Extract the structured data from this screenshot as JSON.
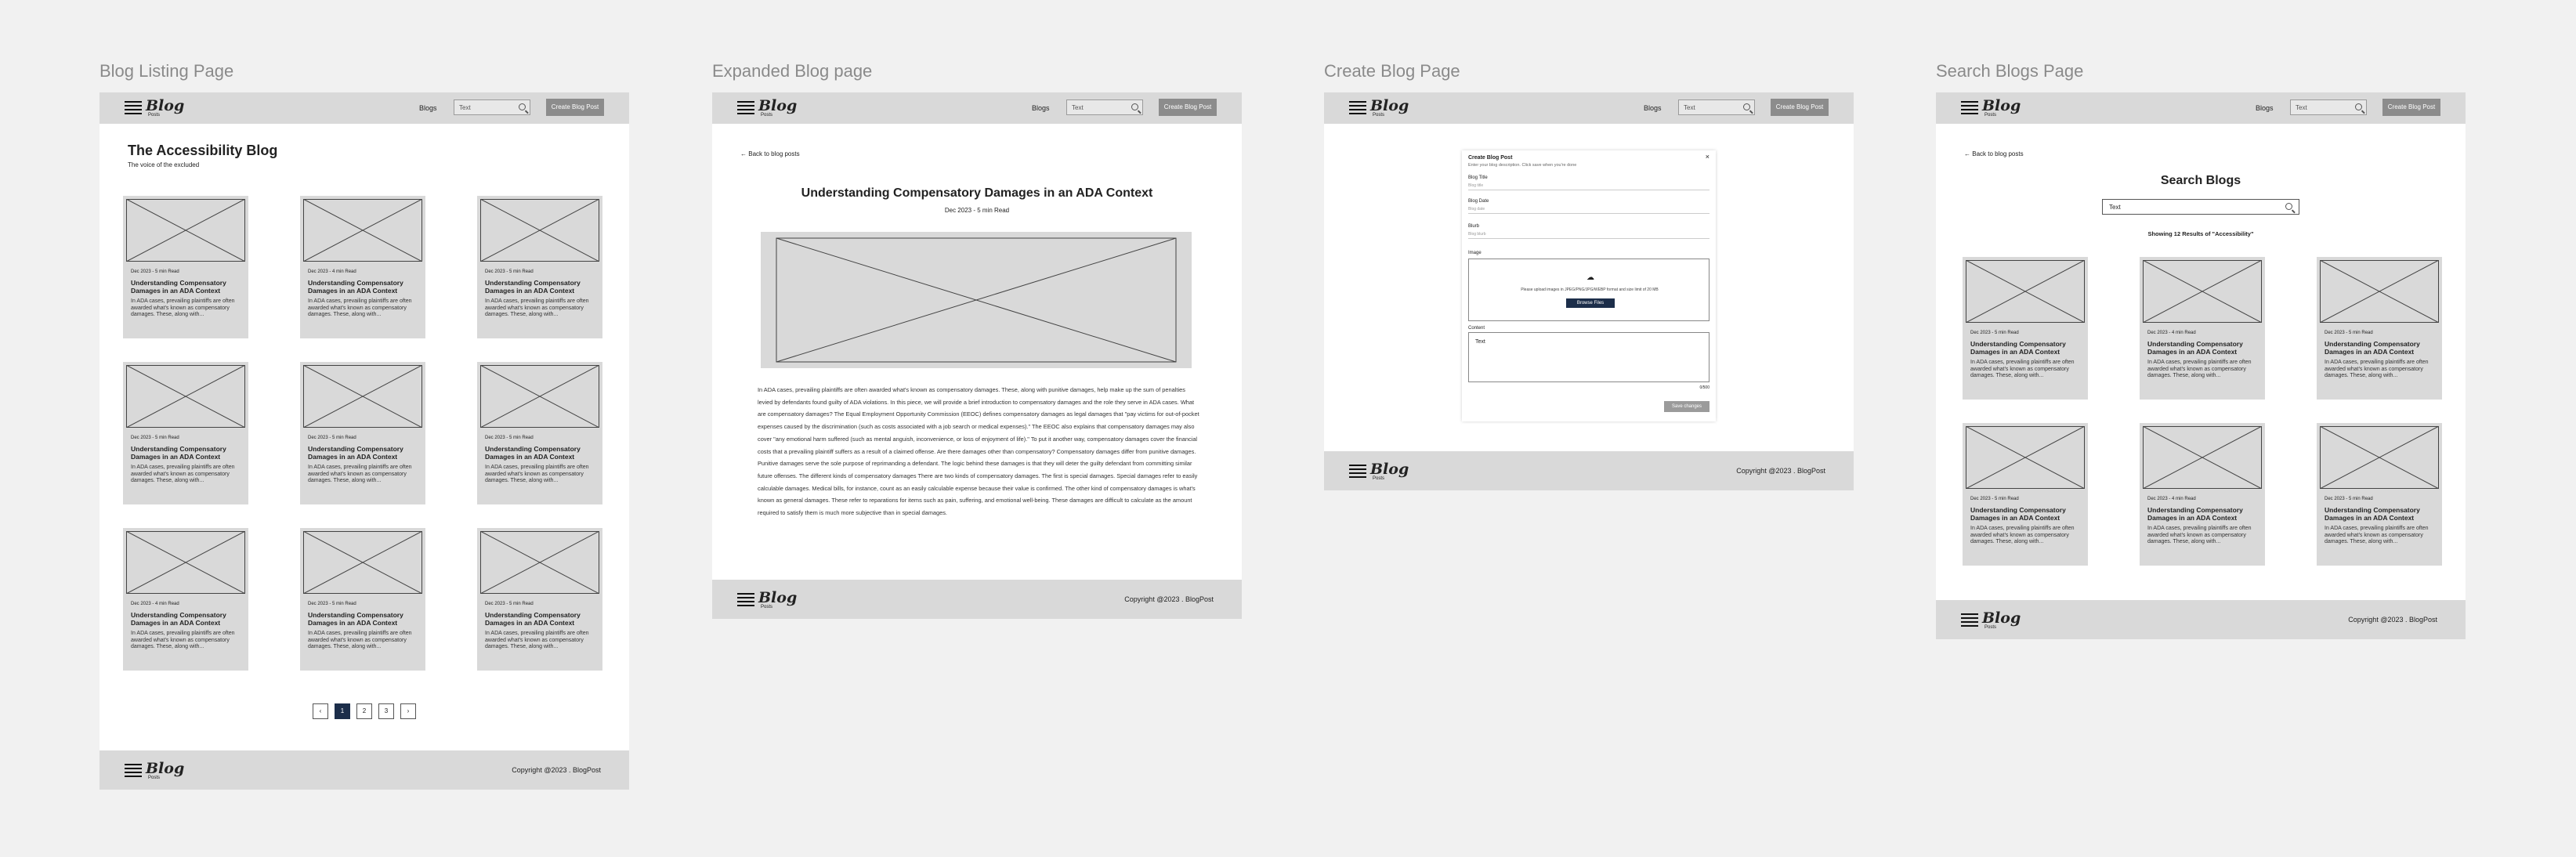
{
  "header": {
    "logo_word": "Blog",
    "logo_sub": "Posts",
    "nav_blogs": "Blogs",
    "search_value": "Text",
    "create_button": "Create Blog Post"
  },
  "footer": {
    "logo_word": "Blog",
    "logo_sub": "Posts",
    "copyright": "Copyright @2023 . BlogPost"
  },
  "frame_titles": {
    "listing": "Blog Listing Page",
    "expanded": "Expanded Blog page",
    "create": "Create Blog Page",
    "search": "Search Blogs Page"
  },
  "listing": {
    "title": "The Accessibility Blog",
    "subtitle": "The voice of the excluded",
    "cards": [
      {
        "meta": "Dec 2023 - 5 min Read",
        "title": "Understanding Compensatory Damages in an ADA Context",
        "excerpt": "In ADA cases, prevailing plaintiffs are often awarded what's known as compensatory damages. These, along with..."
      },
      {
        "meta": "Dec 2023 - 4 min Read",
        "title": "Understanding Compensatory Damages in an ADA Context",
        "excerpt": "In ADA cases, prevailing plaintiffs are often awarded what's known as compensatory damages. These, along with..."
      },
      {
        "meta": "Dec 2023 - 5 min Read",
        "title": "Understanding Compensatory Damages in an ADA Context",
        "excerpt": "In ADA cases, prevailing plaintiffs are often awarded what's known as compensatory damages. These, along with..."
      },
      {
        "meta": "Dec 2023 - 5 min Read",
        "title": "Understanding Compensatory Damages in an ADA Context",
        "excerpt": "In ADA cases, prevailing plaintiffs are often awarded what's known as compensatory damages. These, along with..."
      },
      {
        "meta": "Dec 2023 - 5 min Read",
        "title": "Understanding Compensatory Damages in an ADA Context",
        "excerpt": "In ADA cases, prevailing plaintiffs are often awarded what's known as compensatory damages. These, along with..."
      },
      {
        "meta": "Dec 2023 - 5 min Read",
        "title": "Understanding Compensatory Damages in an ADA Context",
        "excerpt": "In ADA cases, prevailing plaintiffs are often awarded what's known as compensatory damages. These, along with..."
      },
      {
        "meta": "Dec 2023 - 4 min Read",
        "title": "Understanding Compensatory Damages in an ADA Context",
        "excerpt": "In ADA cases, prevailing plaintiffs are often awarded what's known as compensatory damages. These, along with..."
      },
      {
        "meta": "Dec 2023 - 5 min Read",
        "title": "Understanding Compensatory Damages in an ADA Context",
        "excerpt": "In ADA cases, prevailing plaintiffs are often awarded what's known as compensatory damages. These, along with..."
      },
      {
        "meta": "Dec 2023 - 5 min Read",
        "title": "Understanding Compensatory Damages in an ADA Context",
        "excerpt": "In ADA cases, prevailing plaintiffs are often awarded what's known as compensatory damages. These, along with..."
      }
    ],
    "pager": {
      "prev": "‹",
      "pages": [
        "1",
        "2",
        "3"
      ],
      "next": "›"
    }
  },
  "expanded": {
    "back": "Back to blog posts",
    "title": "Understanding Compensatory Damages in an ADA Context",
    "meta": "Dec 2023 - 5 min Read",
    "body": "In ADA cases, prevailing plaintiffs are often awarded what's known as compensatory damages. These, along with punitive damages, help make up the sum of penalties levied by defendants found guilty of ADA violations. In this piece, we will provide a brief introduction to compensatory damages and the role they serve in ADA cases. What are compensatory damages? The Equal Employment Opportunity Commission (EEOC) defines compensatory damages as legal damages that \"pay victims for out-of-pocket expenses caused by the discrimination (such as costs associated with a job search or medical expenses).\" The EEOC also explains that compensatory damages may also cover \"any emotional harm suffered (such as mental anguish, inconvenience, or loss of enjoyment of life).\" To put it another way, compensatory damages cover the financial costs that a prevailing plaintiff suffers as a result of a claimed offense. Are there damages other than compensatory? Compensatory damages differ from punitive damages. Punitive damages serve the sole purpose of reprimanding a defendant. The logic behind these damages is that they will deter the guilty defendant from committing similar future offenses. The different kinds of compensatory damages There are two kinds of compensatory damages. The first is special damages. Special damages refer to easily calculable damages. Medical bills, for instance, count as an easily calculable expense because their value is confirmed. The other kind of compensatory damages is what's known as general damages. These refer to reparations for items such as pain, suffering, and emotional well-being. These damages are difficult to calculate as the amount required to satisfy them is much more subjective than in special damages."
  },
  "create": {
    "form_title": "Create Blog Post",
    "form_subtitle": "Enter your blog description. Click save when you're done",
    "close": "×",
    "blog_title_label": "Blog Title",
    "blog_title_ph": "Blog title",
    "blog_date_label": "Blog Date",
    "blog_date_ph": "Blog date",
    "blurb_label": "Blurb",
    "blurb_ph": "Blog blurb",
    "image_label": "Image",
    "upload_text": "Please upload images in JPEG/PNG/JPG/WEBP format and size limit of 20 MB",
    "browse": "Browse Files",
    "content_label": "Content",
    "content_value": "Text",
    "char_count": "0/500",
    "save": "Save changes"
  },
  "search": {
    "back": "Back to blog posts",
    "title": "Search Blogs",
    "search_value": "Text",
    "results": "Showing 12 Results of \"Accessibility\"",
    "cards": [
      {
        "meta": "Dec 2023 - 5 min Read",
        "title": "Understanding Compensatory Damages in an ADA Context",
        "excerpt": "In ADA cases, prevailing plaintiffs are often awarded what's known as compensatory damages. These, along with..."
      },
      {
        "meta": "Dec 2023 - 4 min Read",
        "title": "Understanding Compensatory Damages in an ADA Context",
        "excerpt": "In ADA cases, prevailing plaintiffs are often awarded what's known as compensatory damages. These, along with..."
      },
      {
        "meta": "Dec 2023 - 5 min Read",
        "title": "Understanding Compensatory Damages in an ADA Context",
        "excerpt": "In ADA cases, prevailing plaintiffs are often awarded what's known as compensatory damages. These, along with..."
      },
      {
        "meta": "Dec 2023 - 5 min Read",
        "title": "Understanding Compensatory Damages in an ADA Context",
        "excerpt": "In ADA cases, prevailing plaintiffs are often awarded what's known as compensatory damages. These, along with..."
      },
      {
        "meta": "Dec 2023 - 4 min Read",
        "title": "Understanding Compensatory Damages in an ADA Context",
        "excerpt": "In ADA cases, prevailing plaintiffs are often awarded what's known as compensatory damages. These, along with..."
      },
      {
        "meta": "Dec 2023 - 5 min Read",
        "title": "Understanding Compensatory Damages in an ADA Context",
        "excerpt": "In ADA cases, prevailing plaintiffs are often awarded what's known as compensatory damages. These, along with..."
      }
    ]
  }
}
